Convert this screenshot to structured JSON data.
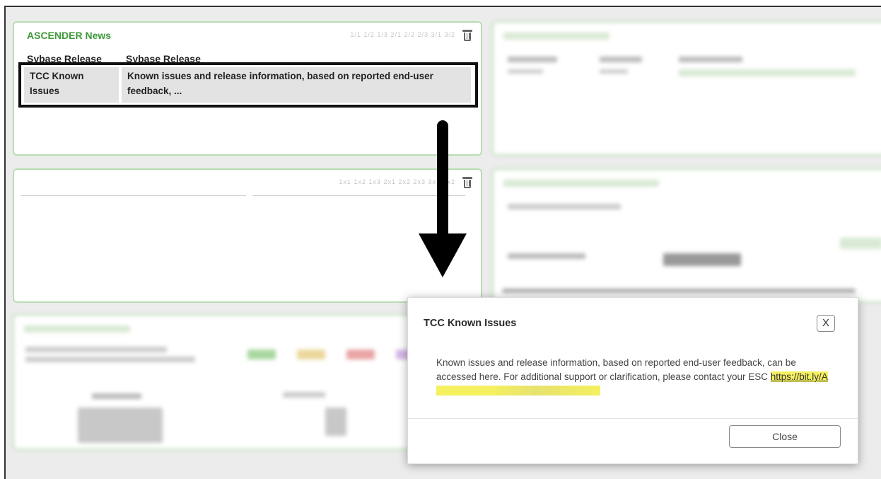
{
  "news_widget": {
    "title": "ASCENDER News",
    "pager": "1/1  1/2  1/3  2/1  2/2  2/3  3/1  3/2",
    "columns": [
      "Sybase Release",
      "Sybase Release"
    ],
    "row": {
      "title": "TCC Known Issues",
      "summary": "Known issues and release information, based on reported end-user feedback, ..."
    }
  },
  "empty_widget": {
    "pager": "1x1  1x2  1x3  2x1  2x2  2x3  3x1  3x2"
  },
  "dialog": {
    "title": "TCC Known Issues",
    "close_x": "X",
    "body_text": "Known issues and release information, based on reported end-user feedback, can be accessed here. For additional support or clarification, please contact your ESC",
    "link_text": "https://bit.ly/A",
    "close_button": "Close"
  },
  "colors": {
    "widget_border": "#b9ddb2",
    "title_green": "#3d9a3a",
    "highlight": "#f4f060"
  }
}
